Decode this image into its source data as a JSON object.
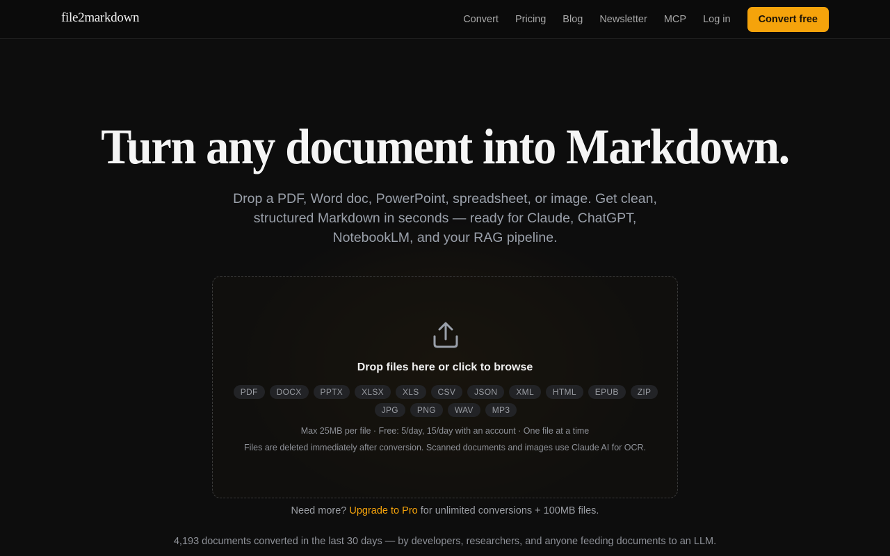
{
  "nav": {
    "logo": "file2markdown",
    "links": [
      "Convert",
      "Pricing",
      "Blog",
      "Newsletter",
      "MCP",
      "Log in"
    ],
    "cta": "Convert free"
  },
  "hero": {
    "title": "Turn any document into Markdown.",
    "subtitle": "Drop a PDF, Word doc, PowerPoint, spreadsheet, or image. Get clean, structured Markdown in seconds — ready for Claude, ChatGPT, NotebookLM, and your RAG pipeline."
  },
  "dropzone": {
    "icon": "upload-icon",
    "title": "Drop files here or click to browse",
    "formats": [
      "PDF",
      "DOCX",
      "PPTX",
      "XLSX",
      "XLS",
      "CSV",
      "JSON",
      "XML",
      "HTML",
      "EPUB",
      "ZIP",
      "JPG",
      "PNG",
      "WAV",
      "MP3"
    ],
    "limits": "Max 25MB per file · Free: 5/day, 15/day with an account · One file at a time",
    "privacy": "Files are deleted immediately after conversion. Scanned documents and images use Claude AI for OCR."
  },
  "upsell": {
    "prefix": "Need more?",
    "link": "Upgrade to Pro",
    "suffix": "for unlimited conversions + 100MB files."
  },
  "stats": "4,193 documents converted in the last 30 days — by developers, researchers, and anyone feeding documents to an LLM.",
  "colors": {
    "accent": "#f5a30b",
    "background": "#0d0d0d"
  }
}
